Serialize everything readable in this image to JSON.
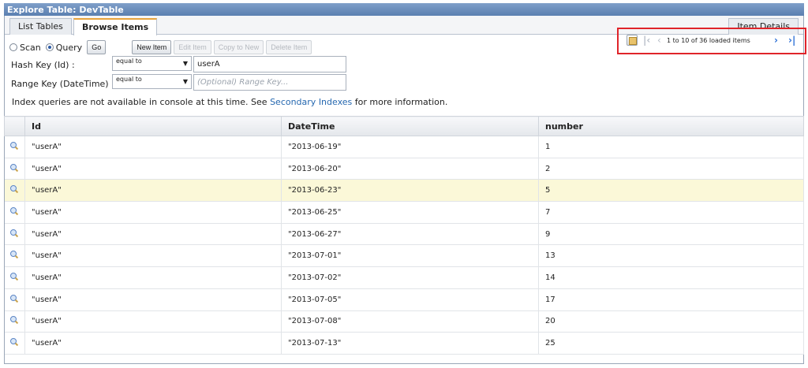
{
  "window": {
    "title": "Explore Table: DevTable"
  },
  "tabs": {
    "list_tables": "List Tables",
    "browse_items": "Browse Items",
    "item_details": "Item Details"
  },
  "mode": {
    "scan": "Scan",
    "query": "Query",
    "selected": "Query"
  },
  "buttons": {
    "go": "Go",
    "new_item": "New Item",
    "edit_item": "Edit Item",
    "copy_to_new": "Copy to New",
    "delete_item": "Delete Item"
  },
  "hash_key": {
    "label": "Hash Key (Id) :",
    "operator": "equal to",
    "value": "userA"
  },
  "range_key": {
    "label": "Range Key (DateTime) :",
    "operator": "equal to",
    "placeholder": "(Optional) Range Key..."
  },
  "info": {
    "text_before": "Index queries are not available in console at this time. See ",
    "link": "Secondary Indexes",
    "text_after": " for more information."
  },
  "pager": {
    "count_text": "1 to 10 of 36 loaded items"
  },
  "table": {
    "headers": [
      "Id",
      "DateTime",
      "number"
    ],
    "rows": [
      [
        "\"userA\"",
        "\"2013-06-19\"",
        "1"
      ],
      [
        "\"userA\"",
        "\"2013-06-20\"",
        "2"
      ],
      [
        "\"userA\"",
        "\"2013-06-23\"",
        "5"
      ],
      [
        "\"userA\"",
        "\"2013-06-25\"",
        "7"
      ],
      [
        "\"userA\"",
        "\"2013-06-27\"",
        "9"
      ],
      [
        "\"userA\"",
        "\"2013-07-01\"",
        "13"
      ],
      [
        "\"userA\"",
        "\"2013-07-02\"",
        "14"
      ],
      [
        "\"userA\"",
        "\"2013-07-05\"",
        "17"
      ],
      [
        "\"userA\"",
        "\"2013-07-08\"",
        "20"
      ],
      [
        "\"userA\"",
        "\"2013-07-13\"",
        "25"
      ]
    ],
    "highlighted_row": 2
  },
  "colors": {
    "accent": "#2b5aa5",
    "highlight": "#fbf8d8",
    "annotation": "#e0242a",
    "active_tab": "#e8a33c"
  }
}
